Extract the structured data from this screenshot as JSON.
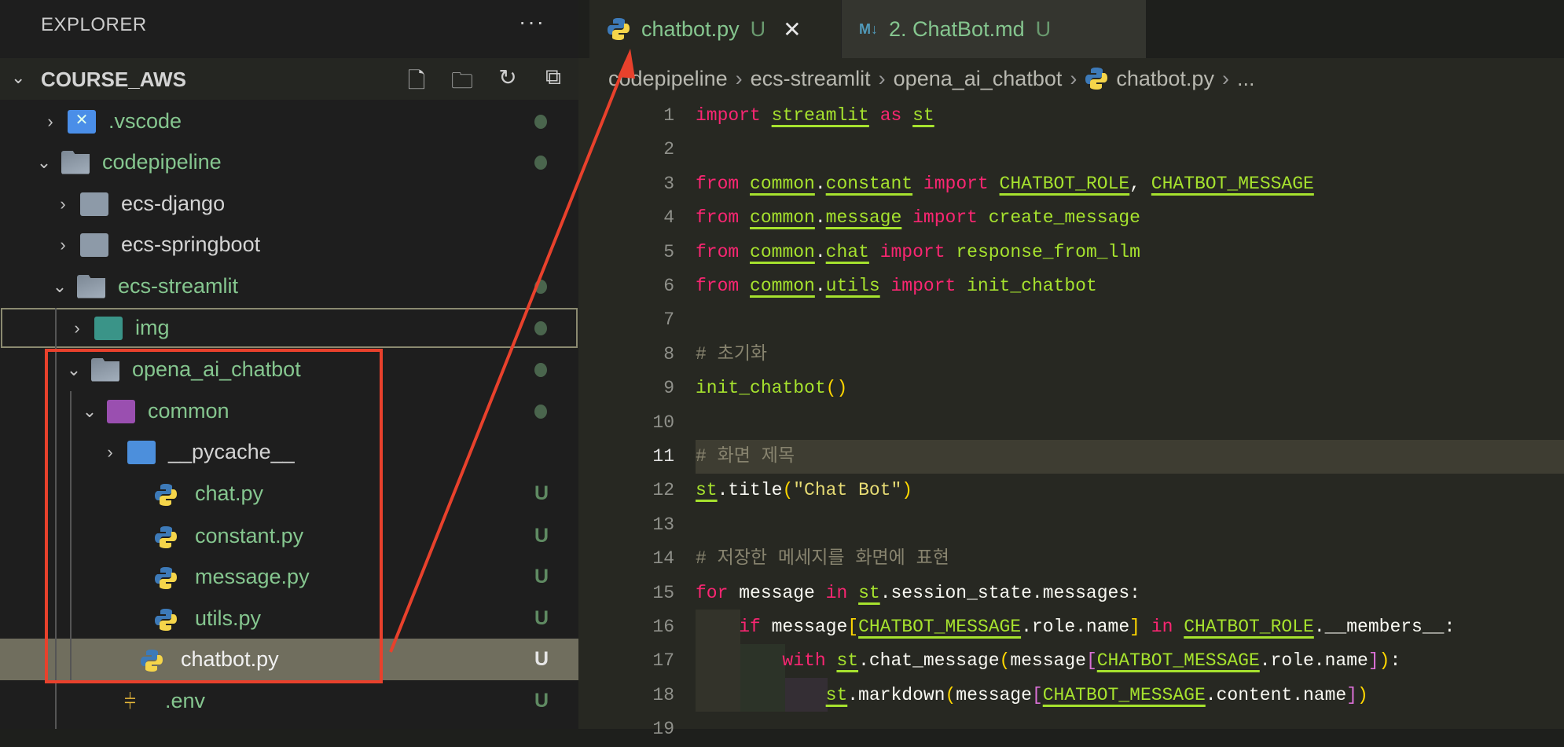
{
  "sidebar": {
    "title": "EXPLORER",
    "more": "···",
    "root": "COURSE_AWS",
    "actions": [
      "new-file",
      "new-folder",
      "refresh",
      "collapse-all"
    ],
    "items": [
      {
        "label": ".vscode",
        "status": "dot"
      },
      {
        "label": "codepipeline",
        "status": "dot"
      },
      {
        "label": "ecs-django",
        "status": ""
      },
      {
        "label": "ecs-springboot",
        "status": ""
      },
      {
        "label": "ecs-streamlit",
        "status": "dot"
      },
      {
        "label": "img",
        "status": "dot"
      },
      {
        "label": "opena_ai_chatbot",
        "status": "dot"
      },
      {
        "label": "common",
        "status": "dot"
      },
      {
        "label": "__pycache__",
        "status": ""
      },
      {
        "label": "chat.py",
        "status": "U"
      },
      {
        "label": "constant.py",
        "status": "U"
      },
      {
        "label": "message.py",
        "status": "U"
      },
      {
        "label": "utils.py",
        "status": "U"
      },
      {
        "label": "chatbot.py",
        "status": "U"
      },
      {
        "label": ".env",
        "status": "U"
      }
    ]
  },
  "tabs": [
    {
      "label": "chatbot.py",
      "badge": "U",
      "close": "✕",
      "md_icon": ""
    },
    {
      "label": "2. ChatBot.md",
      "badge": "U",
      "md_icon": "M↓"
    }
  ],
  "breadcrumb": [
    "codepipeline",
    "ecs-streamlit",
    "opena_ai_chatbot",
    "chatbot.py",
    "..."
  ],
  "breadcrumb_sep": "›",
  "editor": {
    "current_line": 11,
    "lines": [
      [
        [
          "import",
          "kw"
        ],
        [
          " ",
          "pl"
        ],
        [
          "streamlit",
          "mod"
        ],
        [
          " ",
          "pl"
        ],
        [
          "as",
          "kw"
        ],
        [
          " ",
          "pl"
        ],
        [
          "st",
          "mod"
        ]
      ],
      [],
      [
        [
          "from",
          "kw"
        ],
        [
          " ",
          "pl"
        ],
        [
          "common",
          "mod"
        ],
        [
          ".",
          "pl"
        ],
        [
          "constant",
          "mod"
        ],
        [
          " ",
          "pl"
        ],
        [
          "import",
          "kw"
        ],
        [
          " ",
          "pl"
        ],
        [
          "CHATBOT_ROLE",
          "mod"
        ],
        [
          ", ",
          "pl"
        ],
        [
          "CHATBOT_MESSAGE",
          "mod"
        ]
      ],
      [
        [
          "from",
          "kw"
        ],
        [
          " ",
          "pl"
        ],
        [
          "common",
          "mod"
        ],
        [
          ".",
          "pl"
        ],
        [
          "message",
          "mod"
        ],
        [
          " ",
          "pl"
        ],
        [
          "import",
          "kw"
        ],
        [
          " create_message",
          "fn"
        ]
      ],
      [
        [
          "from",
          "kw"
        ],
        [
          " ",
          "pl"
        ],
        [
          "common",
          "mod"
        ],
        [
          ".",
          "pl"
        ],
        [
          "chat",
          "mod"
        ],
        [
          " ",
          "pl"
        ],
        [
          "import",
          "kw"
        ],
        [
          " response_from_llm",
          "fn"
        ]
      ],
      [
        [
          "from",
          "kw"
        ],
        [
          " ",
          "pl"
        ],
        [
          "common",
          "mod"
        ],
        [
          ".",
          "pl"
        ],
        [
          "utils",
          "mod"
        ],
        [
          " ",
          "pl"
        ],
        [
          "import",
          "kw"
        ],
        [
          " init_chatbot",
          "fn"
        ]
      ],
      [],
      [
        [
          "# 초기화",
          "cmt"
        ]
      ],
      [
        [
          "init_chatbot",
          "fn"
        ],
        [
          "()",
          "b1"
        ]
      ],
      [],
      [
        [
          "# 화면 제목",
          "cmt"
        ]
      ],
      [
        [
          "st",
          "mod"
        ],
        [
          ".title",
          "pl"
        ],
        [
          "(",
          "b1"
        ],
        [
          "\"Chat Bot\"",
          "str"
        ],
        [
          ")",
          "b1"
        ]
      ],
      [],
      [
        [
          "# 저장한 메세지를 화면에 표현",
          "cmt"
        ]
      ],
      [
        [
          "for",
          "kw"
        ],
        [
          " message ",
          "pl"
        ],
        [
          "in",
          "kw"
        ],
        [
          " ",
          "pl"
        ],
        [
          "st",
          "mod"
        ],
        [
          ".session_state.messages:",
          "pl"
        ]
      ],
      [
        [
          "    ",
          "pl"
        ],
        [
          "if",
          "kw"
        ],
        [
          " message",
          "pl"
        ],
        [
          "[",
          "b1"
        ],
        [
          "CHATBOT_MESSAGE",
          "mod"
        ],
        [
          ".role.name",
          "pl"
        ],
        [
          "]",
          "b1"
        ],
        [
          " ",
          "pl"
        ],
        [
          "in",
          "kw"
        ],
        [
          " ",
          "pl"
        ],
        [
          "CHATBOT_ROLE",
          "mod"
        ],
        [
          ".__members__:",
          "pl"
        ]
      ],
      [
        [
          "        ",
          "pl"
        ],
        [
          "with",
          "kw"
        ],
        [
          " ",
          "pl"
        ],
        [
          "st",
          "mod"
        ],
        [
          ".chat_message",
          "pl"
        ],
        [
          "(",
          "b1"
        ],
        [
          "message",
          "pl"
        ],
        [
          "[",
          "b2"
        ],
        [
          "CHATBOT_MESSAGE",
          "mod"
        ],
        [
          ".role.name",
          "pl"
        ],
        [
          "]",
          "b2"
        ],
        [
          ")",
          "b1"
        ],
        [
          ":",
          "pl"
        ]
      ],
      [
        [
          "            ",
          "pl"
        ],
        [
          "st",
          "mod"
        ],
        [
          ".markdown",
          "pl"
        ],
        [
          "(",
          "b1"
        ],
        [
          "message",
          "pl"
        ],
        [
          "[",
          "b2"
        ],
        [
          "CHATBOT_MESSAGE",
          "mod"
        ],
        [
          ".content.name",
          "pl"
        ],
        [
          "]",
          "b2"
        ],
        [
          ")",
          "b1"
        ]
      ],
      []
    ]
  }
}
